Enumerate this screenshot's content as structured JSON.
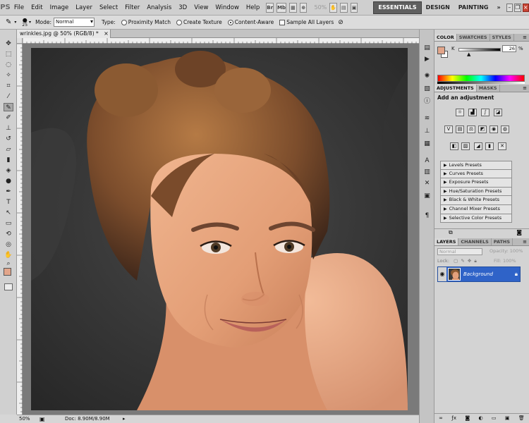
{
  "app": {
    "logo": "PS",
    "menu": [
      "File",
      "Edit",
      "Image",
      "Layer",
      "Select",
      "Filter",
      "Analysis",
      "3D",
      "View",
      "Window",
      "Help"
    ],
    "menubar_badges": [
      "Br",
      "Mb"
    ],
    "zoom": "50%",
    "workspaces": [
      "ESSENTIALS",
      "DESIGN",
      "PAINTING"
    ],
    "overflow": "»"
  },
  "options": {
    "brush_size": "25",
    "mode_label": "Mode:",
    "mode_value": "Normal",
    "type_label": "Type:",
    "type_options": [
      "Proximity Match",
      "Create Texture",
      "Content-Aware"
    ],
    "type_selected": "Content-Aware",
    "sample_all_layers": "Sample All Layers"
  },
  "document": {
    "tab_title": "wrinkles.jpg @ 50% (RGB/8) *",
    "close": "×"
  },
  "status": {
    "zoom": "50%",
    "doc_info": "Doc: 8.90M/8.90M"
  },
  "color_panel": {
    "tabs": [
      "COLOR",
      "SWATCHES",
      "STYLES"
    ],
    "channel": "K",
    "value": "26",
    "unit": "%",
    "foreground": "#e2a58a",
    "background": "#ffffff"
  },
  "adjustments_panel": {
    "tabs": [
      "ADJUSTMENTS",
      "MASKS"
    ],
    "title": "Add an adjustment",
    "presets": [
      "Levels Presets",
      "Curves Presets",
      "Exposure Presets",
      "Hue/Saturation Presets",
      "Black & White Presets",
      "Channel Mixer Presets",
      "Selective Color Presets"
    ]
  },
  "layers_panel": {
    "tabs": [
      "LAYERS",
      "CHANNELS",
      "PATHS"
    ],
    "blend_mode": "Normal",
    "opacity_label": "Opacity: 100%",
    "lock_label": "Lock:",
    "fill_label": "Fill: 100%",
    "layer_name": "Background"
  },
  "colors": {
    "selection": "#2f63c8",
    "canvas_bg": "#3a3a3a"
  }
}
